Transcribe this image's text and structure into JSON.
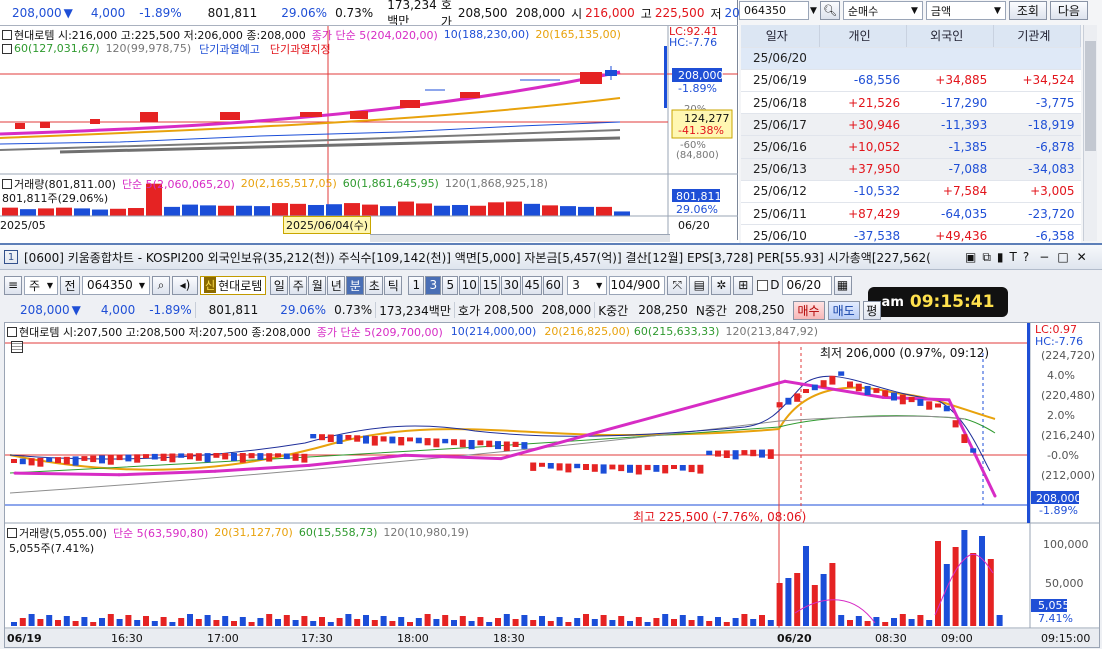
{
  "top_chart": {
    "quote": {
      "price": "208,000",
      "arrow": "▼",
      "change": "4,000",
      "pct": "-1.89%",
      "volume": "801,811",
      "vol_ratio": "29.06%",
      "ratio2": "0.73%",
      "amount": "173,234백만",
      "bid_label": "호가",
      "bid1": "208,500",
      "bid2": "208,000",
      "open_label": "시",
      "open": "216,000",
      "high_label": "고",
      "high": "225,500",
      "low_label": "저",
      "low": "206,000"
    },
    "ohlc_line": "현대로템 시:216,000 고:225,500 저:206,000 종:208,000",
    "ma_line_close": "종가 단순 5(204,020,00)",
    "ma_10": "10(188,230,00)",
    "ma_20": "20(165,135,00)",
    "ma_60": "60(127,031,67)",
    "ma_120": "120(99,978,75)",
    "alert1": "단기과열예고",
    "alert2": "단기과열지정",
    "lc": "LC:92.41",
    "hc": "HC:-7.76",
    "price_tag": "208,000",
    "price_pct": "-1.89%",
    "yaxis_pct": "20%",
    "yaxis_minus60": "-60%",
    "yaxis_low": "(84,800)",
    "cross_value": "124,277",
    "cross_pct": "-41.38%",
    "volume_line": "거래량(801,811.00)",
    "vol_ma5": "단순 5(2,060,065,20)",
    "vol_ma20": "20(2,165,517,05)",
    "vol_ma60": "60(1,861,645,95)",
    "vol_ma120": "120(1,868,925,18)",
    "vol_value": "801,811주(29.06%)",
    "vol_tag": "801,811",
    "vol_tag_pct": "29.06%",
    "x_left": "2025/05",
    "x_cursor": "2025/06/04(수)",
    "x_right": "06/20",
    "volume_bars": [
      22,
      18,
      20,
      22,
      20,
      17,
      19,
      21,
      85,
      24,
      30,
      28,
      27,
      27,
      26,
      34,
      32,
      29,
      31,
      34,
      30,
      26,
      38,
      33,
      27,
      29,
      27,
      36,
      38,
      32,
      28,
      26,
      24,
      24,
      12
    ],
    "volume_bars_up": [
      1,
      0,
      1,
      1,
      0,
      0,
      1,
      1,
      1,
      0,
      0,
      0,
      1,
      0,
      0,
      1,
      1,
      0,
      0,
      1,
      1,
      0,
      1,
      1,
      0,
      0,
      1,
      1,
      1,
      0,
      1,
      0,
      0,
      1,
      0
    ]
  },
  "investor_panel": {
    "code": "064350",
    "mode": "순매수",
    "unit": "금액",
    "query_btn": "조회",
    "next_btn": "다음",
    "headers": [
      "일자",
      "개인",
      "외국인",
      "기관계"
    ],
    "rows": [
      {
        "date": "25/06/20",
        "ind": "",
        "frg": "",
        "inst": ""
      },
      {
        "date": "25/06/19",
        "ind": "-68,556",
        "frg": "+34,885",
        "inst": "+34,524"
      },
      {
        "date": "25/06/18",
        "ind": "+21,526",
        "frg": "-17,290",
        "inst": "-3,775"
      },
      {
        "date": "25/06/17",
        "ind": "+30,946",
        "frg": "-11,393",
        "inst": "-18,919"
      },
      {
        "date": "25/06/16",
        "ind": "+10,052",
        "frg": "-1,385",
        "inst": "-6,878"
      },
      {
        "date": "25/06/13",
        "ind": "+37,950",
        "frg": "-7,088",
        "inst": "-34,083"
      },
      {
        "date": "25/06/12",
        "ind": "-10,532",
        "frg": "+7,584",
        "inst": "+3,005"
      },
      {
        "date": "25/06/11",
        "ind": "+87,429",
        "frg": "-64,035",
        "inst": "-23,720"
      },
      {
        "date": "25/06/10",
        "ind": "-37,538",
        "frg": "+49,436",
        "inst": "-6,358"
      }
    ]
  },
  "window": {
    "title": "[0600] 키움종합차트 - KOSPI200 외국인보유(35,212(천)) 주식수[109,142(천)] 액면[5,000] 자본금[5,457(억)] 결산[12월] EPS[3,728] PER[55.93] 시가총액[227,562(",
    "number": "1"
  },
  "toolbar": {
    "type": "주",
    "prev": "전",
    "code": "064350",
    "badge": "신",
    "name": "현대로템",
    "periods": [
      "일",
      "주",
      "월",
      "년",
      "분",
      "초",
      "틱"
    ],
    "active_period": "분",
    "intervals": [
      "1",
      "3",
      "5",
      "10",
      "15",
      "30",
      "45",
      "60"
    ],
    "active_interval": "3",
    "interval_select": "3",
    "count": "104/900",
    "d_label": "D",
    "date": "06/20",
    "buy": "매수",
    "sell": "매도",
    "avg": "평"
  },
  "clock": {
    "prefix": "am",
    "time": "09:15:41"
  },
  "quote2": {
    "price": "208,000",
    "arrow": "▼",
    "change": "4,000",
    "pct": "-1.89%",
    "volume": "801,811",
    "vol_ratio": "29.06%",
    "ratio2": "0.73%",
    "amount": "173,234백만",
    "bid_label": "호가",
    "bid1": "208,500",
    "bid2": "208,000",
    "k_label": "K중간",
    "k_value": "208,250",
    "n_label": "N중간",
    "n_value": "208,250"
  },
  "main_chart": {
    "ohlc_line": "현대로템 시:207,500 고:208,500 저:207,500 종:208,000",
    "ma_close": "종가 단순 5(209,700,00)",
    "ma_10": "10(214,000,00)",
    "ma_20": "20(216,825,00)",
    "ma_60": "60(215,633,33)",
    "ma_120": "120(213,847,92)",
    "low_note": "최저 206,000 (0.97%, 09:12)",
    "high_note": "최고 225,500 (-7.76%, 08:06)",
    "lc": "LC:0.97",
    "hc": "HC:-7.76",
    "y_labels": [
      "(224,720)",
      "4.0%",
      "(220,480)",
      "2.0%",
      "(216,240)",
      "-0.0%",
      "(212,000)"
    ],
    "price_tag": "208,000",
    "price_pct": "-1.89%",
    "volume_line": "거래량(5,055.00)",
    "vol_ma5": "단순 5(63,590,80)",
    "vol_ma20": "20(31,127,70)",
    "vol_ma60": "60(15,558,73)",
    "vol_ma120": "120(10,980,19)",
    "vol_value": "5,055주(7.41%)",
    "vol_y": [
      "100,000",
      "50,000"
    ],
    "vol_tag": "5,055",
    "vol_tag_pct": "7.41%",
    "x_labels": [
      "06/19",
      "16:30",
      "17:00",
      "17:30",
      "18:00",
      "18:30",
      "06/20",
      "08:30",
      "09:00",
      "09:15:00"
    ]
  },
  "chart_data": {
    "type": "line",
    "title": "",
    "xlabel": "",
    "ylabel": "",
    "x": [
      "06/19",
      "16:30",
      "17:00",
      "17:30",
      "18:00",
      "18:30",
      "06/20",
      "08:30",
      "09:00",
      "09:15"
    ],
    "series": [
      {
        "name": "",
        "values": [
          210700,
          210500,
          210900,
          211600,
          212800,
          212400,
          221500,
          219600,
          219300,
          208000
        ]
      }
    ],
    "ylim": [
      206000,
      226000
    ],
    "grid": false
  }
}
